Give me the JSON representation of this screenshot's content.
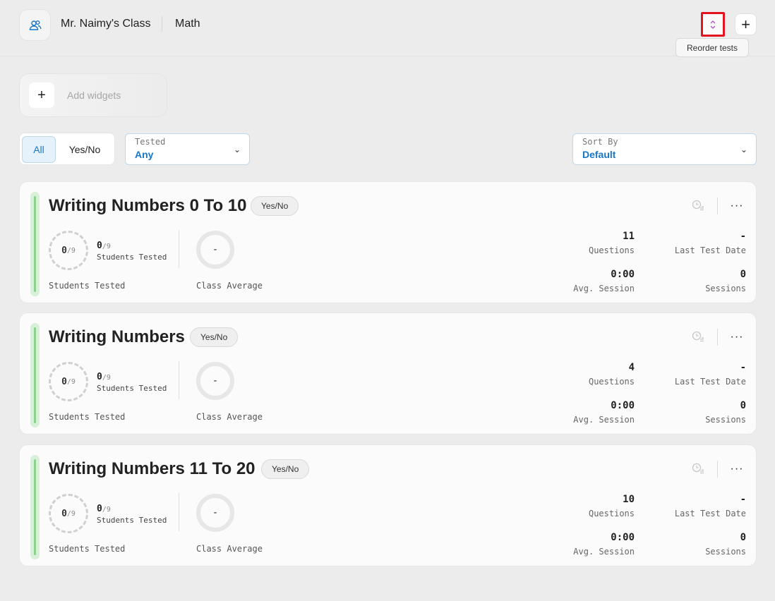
{
  "header": {
    "class_name": "Mr. Naimy's Class",
    "subject": "Math",
    "reorder_tooltip": "Reorder tests",
    "add_icon": "+"
  },
  "widgets": {
    "plus": "+",
    "label": "Add widgets"
  },
  "filters": {
    "segments": [
      "All",
      "Yes/No"
    ],
    "tested": {
      "label": "Tested",
      "value": "Any"
    },
    "sort": {
      "label": "Sort By",
      "value": "Default"
    },
    "chevron": "⌄"
  },
  "cards": [
    {
      "title": "Writing Numbers 0 To 10",
      "badge": "Yes/No",
      "tested_count": "0",
      "total_students": "/9",
      "students_tested_label": "Students Tested",
      "class_average": "-",
      "class_average_label": "Class Average",
      "questions": "11",
      "questions_label": "Questions",
      "last_test_date": "-",
      "last_test_date_label": "Last Test Date",
      "avg_session": "0:00",
      "avg_session_label": "Avg. Session",
      "sessions": "0",
      "sessions_label": "Sessions",
      "more": "···"
    },
    {
      "title": "Writing Numbers",
      "badge": "Yes/No",
      "tested_count": "0",
      "total_students": "/9",
      "students_tested_label": "Students Tested",
      "class_average": "-",
      "class_average_label": "Class Average",
      "questions": "4",
      "questions_label": "Questions",
      "last_test_date": "-",
      "last_test_date_label": "Last Test Date",
      "avg_session": "0:00",
      "avg_session_label": "Avg. Session",
      "sessions": "0",
      "sessions_label": "Sessions",
      "more": "···"
    },
    {
      "title": "Writing Numbers 11 To 20",
      "badge": "Yes/No",
      "tested_count": "0",
      "total_students": "/9",
      "students_tested_label": "Students Tested",
      "class_average": "-",
      "class_average_label": "Class Average",
      "questions": "10",
      "questions_label": "Questions",
      "last_test_date": "-",
      "last_test_date_label": "Last Test Date",
      "avg_session": "0:00",
      "avg_session_label": "Avg. Session",
      "sessions": "0",
      "sessions_label": "Sessions",
      "more": "···"
    }
  ],
  "colors": {
    "accent": "#1677c8",
    "highlight_border": "#e3141f",
    "progress_bar": "#8fd08f",
    "reorder_icon": "#b04fc4"
  },
  "icons": {
    "class": "users-icon",
    "reorder": "reorder-arrows-icon",
    "history": "history-icon",
    "more": "more-horizontal-icon"
  }
}
